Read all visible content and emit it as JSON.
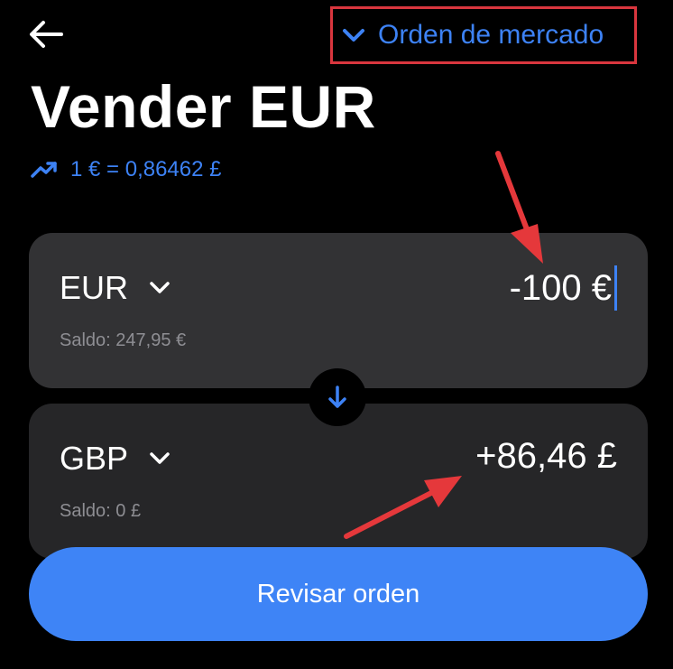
{
  "header": {
    "order_type_label": "Orden de mercado"
  },
  "title": "Vender EUR",
  "rate": {
    "text": "1 € = 0,86462 £"
  },
  "from": {
    "currency": "EUR",
    "amount": "-100 €",
    "balance": "Saldo: 247,95 €"
  },
  "to": {
    "currency": "GBP",
    "amount": "+86,46 £",
    "balance": "Saldo: 0 £"
  },
  "review_button_label": "Revisar orden",
  "colors": {
    "accent": "#3e84f6",
    "highlight_box": "#d9363e",
    "annotation_arrow": "#e5383b",
    "background": "#000000",
    "card": "#2c2c2e"
  },
  "icons": {
    "back": "arrow-left-icon",
    "order_type": "chevron-down-icon",
    "rate": "trend-up-icon",
    "swap": "arrow-down-icon"
  }
}
